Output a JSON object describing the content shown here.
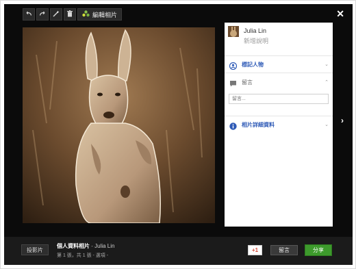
{
  "toolbar": {
    "edit_label": "編輯相片"
  },
  "owner": {
    "name": "Julia Lin",
    "description_placeholder": "新增說明"
  },
  "panel": {
    "tag_people_label": "標記人物",
    "comments_label": "留言",
    "comment_placeholder": "留言...",
    "photo_details_label": "相片詳細資料"
  },
  "footer": {
    "slideshow_label": "投影片",
    "album_title": "個人資料相片",
    "album_separator": " - ",
    "album_owner": "Julia Lin",
    "counter": "第 1 張，共 1 張 - 選項 -",
    "plus_one_label": "+1",
    "comment_button": "留言",
    "share_button": "分享"
  },
  "colors": {
    "accent_blue": "#2f5bb7",
    "share_green": "#3d9a2c",
    "plus_one_red": "#d14836"
  },
  "icons": [
    "undo-icon",
    "redo-icon",
    "magic-wand-icon",
    "trash-icon",
    "edit-photo-icon",
    "close-icon",
    "tag-person-icon",
    "comment-icon",
    "info-icon",
    "next-arrow-icon",
    "chevron-down-icon",
    "chevron-up-icon"
  ]
}
